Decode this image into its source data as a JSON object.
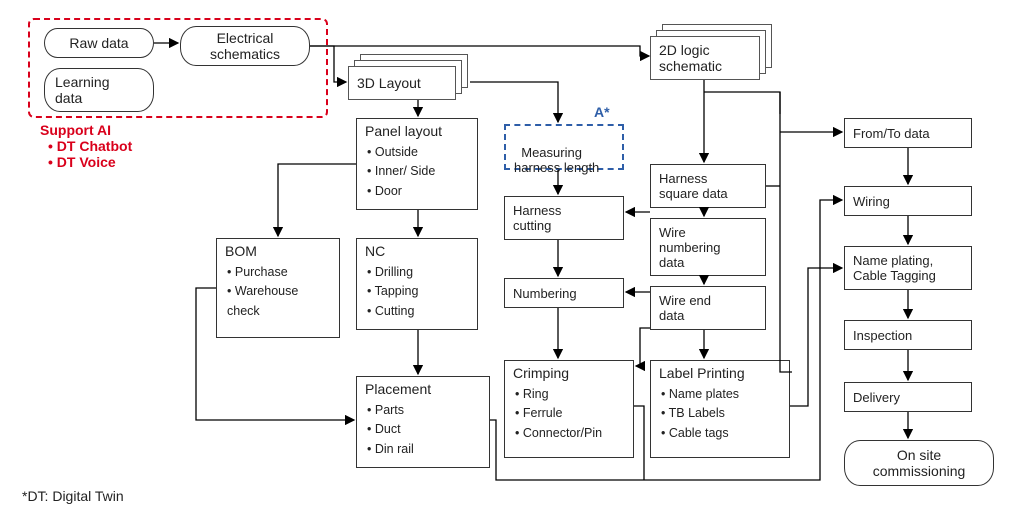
{
  "support_ai": {
    "title": "Support AI",
    "items": [
      "DT Chatbot",
      "DT Voice"
    ]
  },
  "raw_data": "Raw data",
  "learning_data": "Learning\ndata",
  "electrical_schematics": "Electrical\nschematics",
  "layout_3d": "3D Layout",
  "logic_2d": "2D logic\nschematic",
  "a_star": "A*",
  "panel_layout": {
    "title": "Panel layout",
    "items": [
      "Outside",
      "Inner/ Side",
      "Door"
    ]
  },
  "bom": {
    "title": "BOM",
    "items": [
      "Purchase",
      "Warehouse check"
    ]
  },
  "nc": {
    "title": "NC",
    "items": [
      "Drilling",
      "Tapping",
      "Cutting"
    ]
  },
  "placement": {
    "title": "Placement",
    "items": [
      "Parts",
      "Duct",
      "Din rail"
    ]
  },
  "measuring": {
    "title": "Measuring\nharness length"
  },
  "harness_cutting": "Harness\ncutting",
  "numbering": "Numbering",
  "crimping": {
    "title": "Crimping",
    "items": [
      "Ring",
      "Ferrule",
      "Connector/Pin"
    ]
  },
  "harness_square": "Harness\nsquare data",
  "wire_numbering": "Wire\nnumbering\ndata",
  "wire_end": "Wire end\ndata",
  "label_printing": {
    "title": "Label Printing",
    "items": [
      "Name plates",
      "TB Labels",
      "Cable tags"
    ]
  },
  "from_to": "From/To data",
  "wiring": "Wiring",
  "name_plating": "Name plating,\nCable Tagging",
  "inspection": "Inspection",
  "delivery": "Delivery",
  "onsite": "On site\ncommissioning",
  "footnote": "*DT: Digital Twin"
}
